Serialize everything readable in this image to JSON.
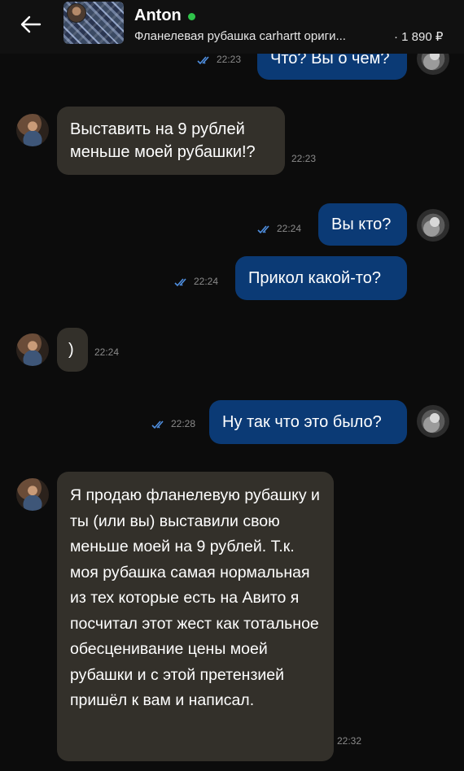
{
  "header": {
    "seller_name": "Anton",
    "listing_title": "Фланелевая рубашка carhartt ориги...",
    "listing_price": "· 1 890 ₽",
    "back_icon": "arrow-left-icon",
    "online_color": "#2fc34a"
  },
  "messages": [
    {
      "from": "me",
      "text": "Что? Вы о чем?",
      "time": "22:23",
      "read": true
    },
    {
      "from": "anton",
      "text": "Выставить на 9 рублей меньше моей рубашки!?",
      "time": "22:23"
    },
    {
      "from": "me",
      "text": "Вы кто?",
      "time": "22:24",
      "read": true
    },
    {
      "from": "me",
      "text": "Прикол какой-то?",
      "time": "22:24",
      "read": true
    },
    {
      "from": "anton",
      "text": ")",
      "time": "22:24"
    },
    {
      "from": "me",
      "text": "Ну так что это было?",
      "time": "22:28",
      "read": true
    },
    {
      "from": "anton",
      "text": "Я продаю фланелевую рубашку и ты (или вы) выставили свою меньше моей на 9 рублей. Т.к. моя рубашка самая нормальная из тех которые есть на Авито я посчитал этот жест как тотальное обесценивание цены моей рубашки и с этой претензией пришёл к вам и написал.",
      "time": "22:32"
    }
  ],
  "colors": {
    "background": "#0c0c0c",
    "incoming_bubble": "#33302a",
    "outgoing_bubble": "#0b3a75",
    "read_check": "#4f8fe0"
  }
}
